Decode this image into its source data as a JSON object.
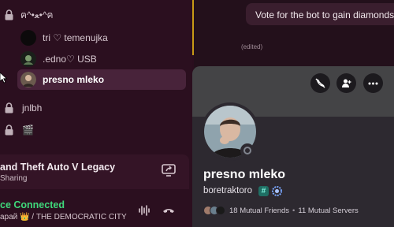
{
  "sidebar": {
    "items": [
      {
        "label": "ฅ^•ﻌ•^ฅ",
        "kind": "channel",
        "icon": "lock-icon"
      },
      {
        "label": "tri ♡ temenujka",
        "kind": "member",
        "icon": "avatar"
      },
      {
        "label": ".edno♡ USB",
        "kind": "member",
        "icon": "avatar"
      },
      {
        "label": "presno mleko",
        "kind": "member",
        "icon": "avatar",
        "selected": true
      },
      {
        "label": "jnlbh",
        "kind": "channel",
        "icon": "lock-icon"
      },
      {
        "label": "🎬",
        "kind": "channel",
        "icon": "lock-icon"
      }
    ]
  },
  "activity": {
    "game_title": "and Theft Auto V Legacy",
    "subtitle": "Sharing",
    "share_icon": "screen-share-icon"
  },
  "voice": {
    "status": "ce Connected",
    "channel": "арай 👑 / THE DEMOCRATIC CITY",
    "status_color": "#3fd97b"
  },
  "chat": {
    "message": "Vote for the bot to gain diamonds",
    "edited": "(edited)"
  },
  "profile": {
    "display_name": "presno mleko",
    "username": "boretraktoro",
    "tag_symbol": "#",
    "mutual_friends": "18 Mutual Friends",
    "separator": "•",
    "mutual_servers": "11 Mutual Servers",
    "actions": [
      "call-off-icon",
      "add-friend-icon",
      "more-icon"
    ]
  },
  "colors": {
    "accent_divider": "#c79a16",
    "sidebar_bg": "#2b0f1f",
    "popout_bg": "#2d2930"
  }
}
